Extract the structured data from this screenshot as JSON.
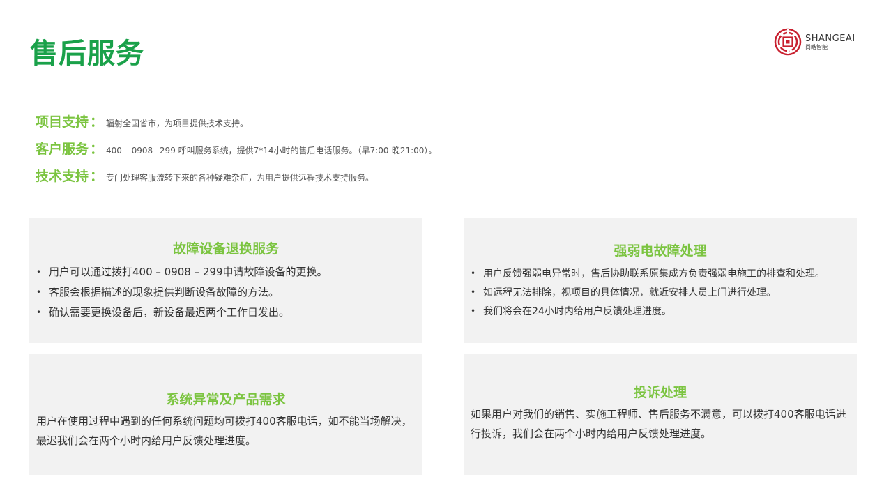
{
  "header": {
    "title": "售后服务"
  },
  "logo": {
    "name_en": "SHANGEAI",
    "name_cn": "尚皓智能",
    "color": "#c8202f"
  },
  "support": [
    {
      "label": "项目支持",
      "colon": "：",
      "text": "辐射全国省市，为项目提供技术支持。"
    },
    {
      "label": "客户服务",
      "colon": "：",
      "text": "400 – 0908– 299 呼叫服务系统，提供7*14小时的售后电话服务。（早7:00-晚21:00）。"
    },
    {
      "label": "技术支持",
      "colon": "：",
      "text": "专门处理客服流转下来的各种疑难杂症，为用户提供远程技术支持服务。"
    }
  ],
  "cards": [
    {
      "title": "故障设备退换服务",
      "bullets": [
        "用户可以通过拨打400 – 0908 – 299申请故障设备的更换。",
        "客服会根据描述的现象提供判断设备故障的方法。",
        "确认需要更换设备后，新设备最迟两个工作日发出。"
      ]
    },
    {
      "title": "强弱电故障处理",
      "bullets": [
        "用户反馈强弱电异常时，售后协助联系原集成方负责强弱电施工的排查和处理。",
        "如远程无法排除，视项目的具体情况，就近安排人员上门进行处理。",
        "我们将会在24小时内给用户反馈处理进度。"
      ]
    },
    {
      "title": "系统异常及产品需求",
      "text": "用户在使用过程中遇到的任何系统问题均可拨打400客服电话，如不能当场解决，最迟我们会在两个小时内给用户反馈处理进度。"
    },
    {
      "title": "投诉处理",
      "text": "如果用户对我们的销售、实施工程师、售后服务不满意，可以拨打400客服电话进行投诉，我们会在两个小时内给用户反馈处理进度。"
    }
  ],
  "bullet_glyph": "•",
  "colors": {
    "title_green": "#1aa14a",
    "accent_green": "#7bc440",
    "card_bg": "#f2f2f2"
  }
}
